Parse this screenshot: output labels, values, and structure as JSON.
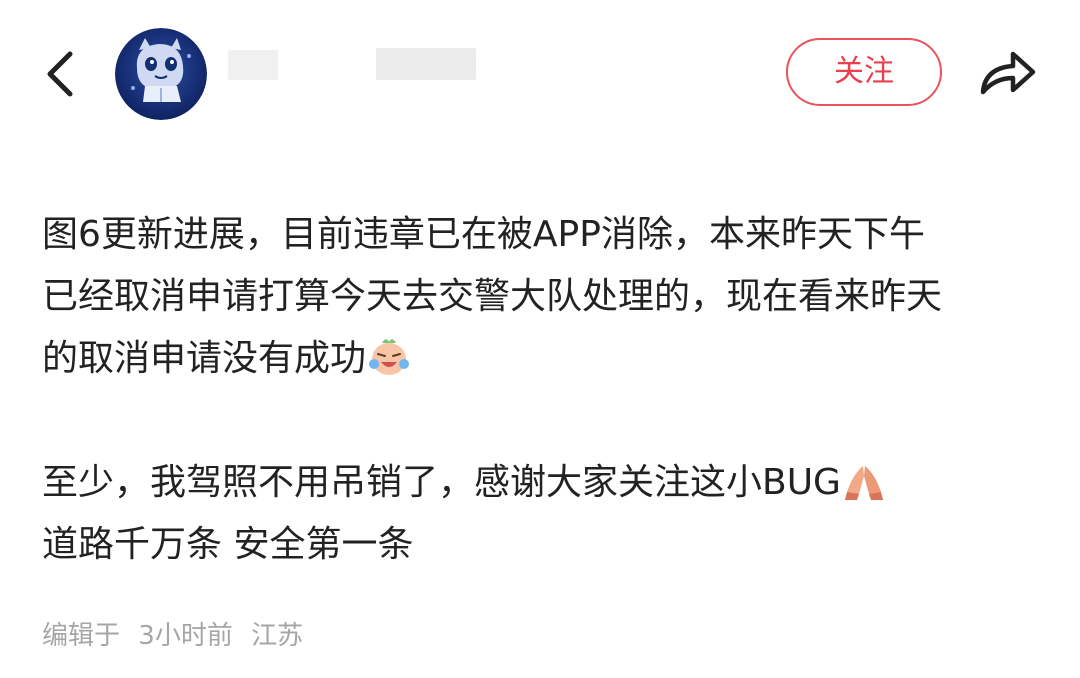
{
  "header": {
    "back_icon": "chevron-left-icon",
    "avatar_icon": "cartoon-avatar-icon",
    "author_name": "",
    "follow_label": "关注",
    "share_icon": "share-arrow-icon",
    "accent_color": "#e9404e"
  },
  "post": {
    "paragraphs": [
      {
        "lines": [
          "图6更新进展，目前违章已在被APP消除，本来昨天下午",
          "已经取消申请打算今天去交警大队处理的，现在看来昨天",
          "的取消申请没有成功"
        ],
        "emoji": "crying-laughing-face-icon"
      },
      {
        "lines": [
          "至少，我驾照不用吊销了，感谢大家关注这小BUG",
          "道路千万条 安全第一条"
        ],
        "emoji": "praying-hands-icon"
      }
    ]
  },
  "meta": {
    "edited_label": "编辑于",
    "time": "3小时前",
    "location": "江苏"
  }
}
